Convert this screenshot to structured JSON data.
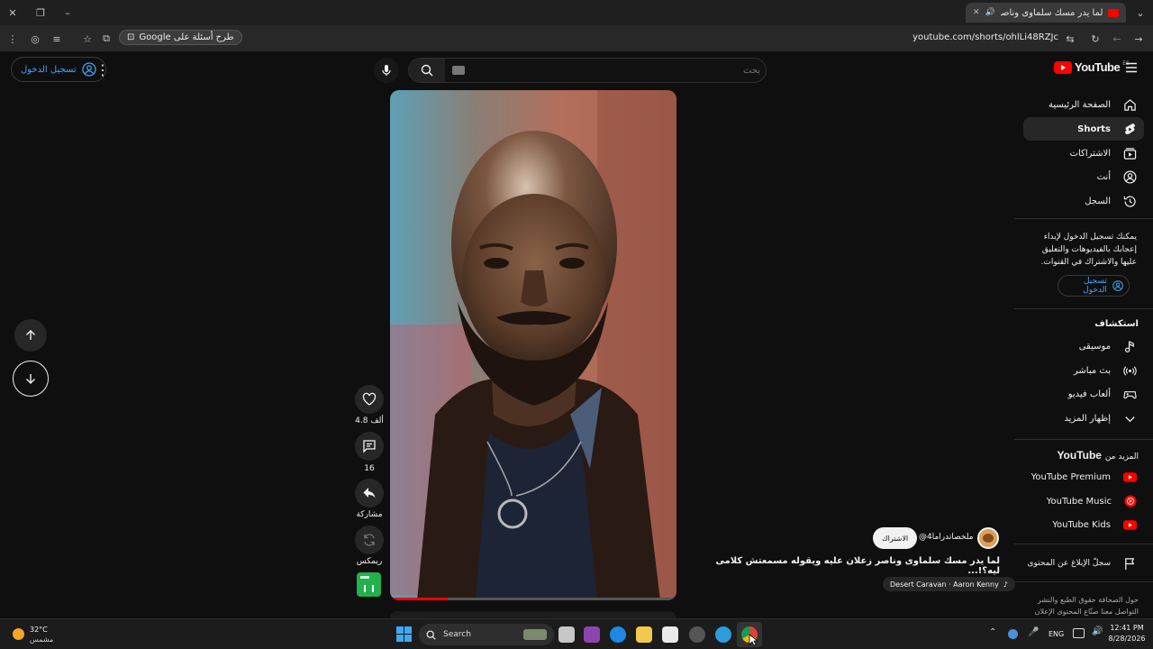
{
  "browser": {
    "tab_title": "لما يدر مسك سلماوى وناصر",
    "url": "youtube.com/shorts/ohlLi48RZJc",
    "ask_google_label": "طرح أسئلة على Google"
  },
  "header": {
    "logo_text": "YouTube",
    "region_code": "ES",
    "search_placeholder": "بحث",
    "signin_label": "تسجيل الدخول"
  },
  "sidebar": {
    "items": [
      {
        "label": "الصفحة الرئيسية",
        "icon": "home-icon"
      },
      {
        "label": "Shorts",
        "icon": "shorts-icon"
      },
      {
        "label": "الاشتراكات",
        "icon": "subscriptions-icon"
      },
      {
        "label": "أنت",
        "icon": "you-icon"
      },
      {
        "label": "السجل",
        "icon": "history-icon"
      }
    ],
    "signin_prompt": "يمكنك تسجيل الدخول لإبداء إعجابك بالفيديوهات والتعليق عليها والاشتراك في القنوات.",
    "signin_label": "تسجيل الدخول",
    "explore_title": "استكشاف",
    "explore": [
      {
        "label": "موسيقى",
        "icon": "music-icon"
      },
      {
        "label": "بث مباشر",
        "icon": "live-icon"
      },
      {
        "label": "ألعاب فيديو",
        "icon": "gaming-icon"
      },
      {
        "label": "إظهار المزيد",
        "icon": "chevron-down-icon"
      }
    ],
    "more_from_prefix": "المزيد من",
    "more_from_brand": "YouTube",
    "more": [
      {
        "label": "YouTube Premium"
      },
      {
        "label": "YouTube Music"
      },
      {
        "label": "YouTube Kids"
      }
    ],
    "report_label": "سجلّ الإبلاغ عن المحتوى",
    "footer_line1": "حول  الصحافة  حقوق الطبع والنشر",
    "footer_line2": "التواصل معنا  صنّاع المحتوى  الإعلان"
  },
  "short": {
    "likes": "4.8 ألف",
    "comments": "16",
    "share_label": "مشاركة",
    "remix_label": "ريمكس",
    "channel": "@ملخصاتدراما4",
    "subscribe_label": "الاشتراك",
    "title": "لما يدر مسك سلماوى وناصر زعلان عليه ويقوله مسمعتش كلامى ليه؟!...",
    "music": "Desert Caravan · Aaron Kenny",
    "progress": 0.2
  },
  "taskbar": {
    "weather_temp": "32°C",
    "weather_desc": "مشمس",
    "search_label": "Search",
    "lang": "ENG",
    "time": "12:41 PM",
    "date": "8/28/2026"
  },
  "colors": {
    "accent": "#3ea6ff",
    "youtube_red": "#ff0000",
    "bg": "#0f0f0f"
  }
}
